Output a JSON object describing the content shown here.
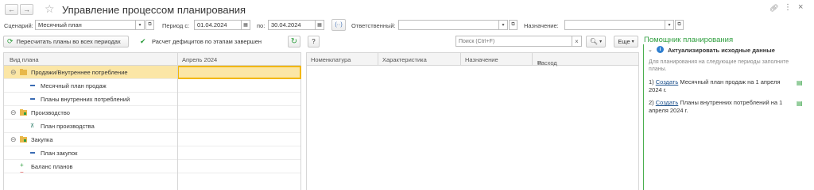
{
  "window": {
    "title": "Управление процессом планирования"
  },
  "filters": {
    "scenario_label": "Сценарий:",
    "scenario_value": "Месячный план",
    "period_from_label": "Период с:",
    "period_from": "01.04.2024",
    "period_to_label": "по:",
    "period_to": "30.04.2024",
    "responsible_label": "Ответственный:",
    "responsible_value": "",
    "purpose_label": "Назначение:",
    "purpose_value": ""
  },
  "toolbar": {
    "recalc_label": "Пересчитать планы во всех периодах",
    "status_text": "Расчет дефицитов по этапам завершен",
    "help_label": "?",
    "search_placeholder": "Поиск (Ctrl+F)",
    "more_label": "Еще"
  },
  "left_grid": {
    "col_kind": "Вид плана",
    "col_period": "Апрель 2024",
    "rows": [
      {
        "label": "Продажи/Внутреннее потребление"
      },
      {
        "label": "Месячный план продаж"
      },
      {
        "label": "Планы внутренних потреблений"
      },
      {
        "label": "Производство"
      },
      {
        "label": "План производства"
      },
      {
        "label": "Закупка"
      },
      {
        "label": "План закупок"
      },
      {
        "label": "Баланс планов"
      }
    ]
  },
  "right_grid": {
    "columns": [
      "Номенклатура",
      "Характеристика",
      "Назначение",
      "Расход"
    ]
  },
  "assistant": {
    "title": "Помощник планирования",
    "section_title": "Актуализировать исходные данные",
    "hint": "Для планирования на следующие периоды заполните планы.",
    "items": [
      {
        "num": "1)",
        "link": "Создать",
        "text": " Месячный план продаж  на 1 апреля 2024 г."
      },
      {
        "num": "2)",
        "link": "Создать",
        "text": " Планы внутренних потреблений  на 1 апреля 2024 г."
      }
    ]
  },
  "colors": {
    "accent_green": "#2e9e3e",
    "selection": "#fbe6a6",
    "selected_cell_border": "#f2b705"
  }
}
